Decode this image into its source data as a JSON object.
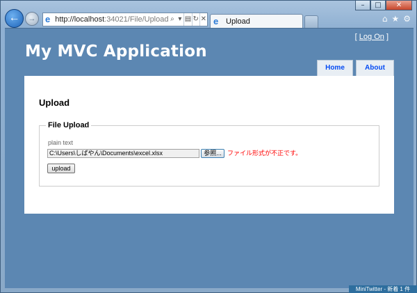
{
  "browser": {
    "url_host": "http://localhost",
    "url_rest": ":34021/File/Upload",
    "tab_title": "Upload",
    "icons": {
      "back": "back-arrow-icon",
      "forward": "forward-arrow-icon",
      "search": "search-icon",
      "home": "home-icon",
      "favorites": "star-icon",
      "tools": "gear-icon"
    }
  },
  "site": {
    "title": "My MVC Application",
    "login_open": "[",
    "login_link": "Log On",
    "login_close": "]",
    "menu": [
      {
        "label": "Home"
      },
      {
        "label": "About"
      }
    ]
  },
  "page": {
    "heading": "Upload",
    "fieldset_legend": "File Upload",
    "field_label": "plain text",
    "file_value": "C:\\Users\\しばやん\\Documents\\excel.xlsx",
    "browse_label": "参照...",
    "error_text": "ファイル形式が不正です。",
    "submit_label": "upload"
  },
  "notification": {
    "text": "MiniTwitter - 新着 1 件"
  },
  "colors": {
    "page_background": "#5c87b2",
    "menu_link": "#034af3",
    "error": "#ff0000"
  }
}
